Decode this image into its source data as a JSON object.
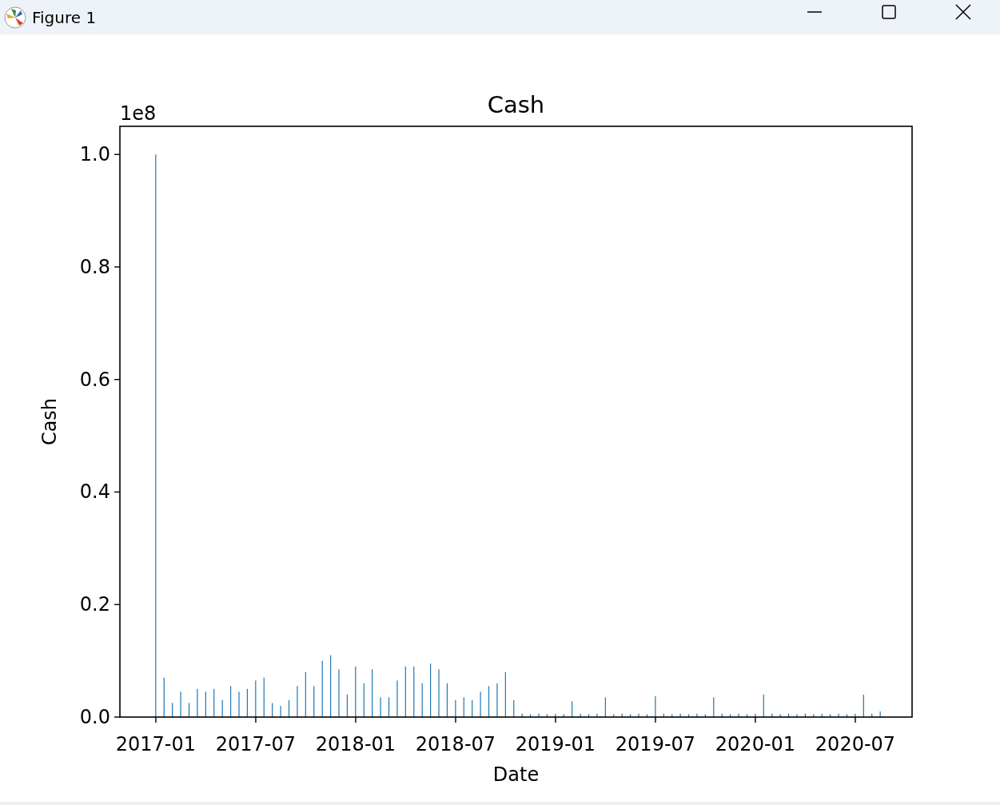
{
  "window": {
    "title": "Figure 1"
  },
  "controls": [
    {
      "kind": "minimize"
    },
    {
      "kind": "maximize"
    },
    {
      "kind": "close"
    }
  ],
  "figure": {
    "offset_label": "1e8",
    "chart_data": {
      "type": "bar",
      "title": "Cash",
      "xlabel": "Date",
      "ylabel": "Cash",
      "ylim": [
        0,
        1.05
      ],
      "yticks": [
        {
          "value": 0,
          "label": "0.0"
        },
        {
          "value": 0.2,
          "label": "0.2"
        },
        {
          "value": 0.4,
          "label": "0.4"
        },
        {
          "value": 0.6,
          "label": "0.6"
        },
        {
          "value": 0.8,
          "label": "0.8"
        },
        {
          "value": 1.0,
          "label": "1.0"
        }
      ],
      "categories": [
        "2017-01",
        null,
        null,
        null,
        null,
        null,
        null,
        null,
        null,
        null,
        null,
        null,
        "2017-07",
        null,
        null,
        null,
        null,
        null,
        null,
        null,
        null,
        null,
        null,
        null,
        "2018-01",
        null,
        null,
        null,
        null,
        null,
        null,
        null,
        null,
        null,
        null,
        null,
        "2018-07",
        null,
        null,
        null,
        null,
        null,
        null,
        null,
        null,
        null,
        null,
        null,
        "2019-01",
        null,
        null,
        null,
        null,
        null,
        null,
        null,
        null,
        null,
        null,
        null,
        "2019-07",
        null,
        null,
        null,
        null,
        null,
        null,
        null,
        null,
        null,
        null,
        null,
        "2020-01",
        null,
        null,
        null,
        null,
        null,
        null,
        null,
        null,
        null,
        null,
        null,
        "2020-07",
        null,
        null,
        null
      ],
      "series": [
        {
          "color": "#1f77b4",
          "values": [
            1.0,
            0.07,
            0.025,
            0.045,
            0.025,
            0.05,
            0.045,
            0.05,
            0.03,
            0.055,
            0.045,
            0.05,
            0.065,
            0.07,
            0.025,
            0.02,
            0.03,
            0.055,
            0.08,
            0.055,
            0.1,
            0.11,
            0.085,
            0.04,
            0.09,
            0.06,
            0.085,
            0.035,
            0.035,
            0.065,
            0.09,
            0.09,
            0.06,
            0.095,
            0.085,
            0.06,
            0.03,
            0.035,
            0.03,
            0.045,
            0.055,
            0.06,
            0.08,
            0.03,
            0.006,
            0.005,
            0.006,
            0.005,
            0.006,
            0.005,
            0.028,
            0.006,
            0.005,
            0.006,
            0.035,
            0.005,
            0.006,
            0.005,
            0.006,
            0.005,
            0.037,
            0.006,
            0.005,
            0.006,
            0.005,
            0.006,
            0.005,
            0.035,
            0.006,
            0.005,
            0.006,
            0.005,
            0.006,
            0.04,
            0.006,
            0.005,
            0.006,
            0.005,
            0.006,
            0.005,
            0.006,
            0.005,
            0.006,
            0.005,
            0.006,
            0.04,
            0.006,
            0.01
          ]
        }
      ]
    }
  }
}
